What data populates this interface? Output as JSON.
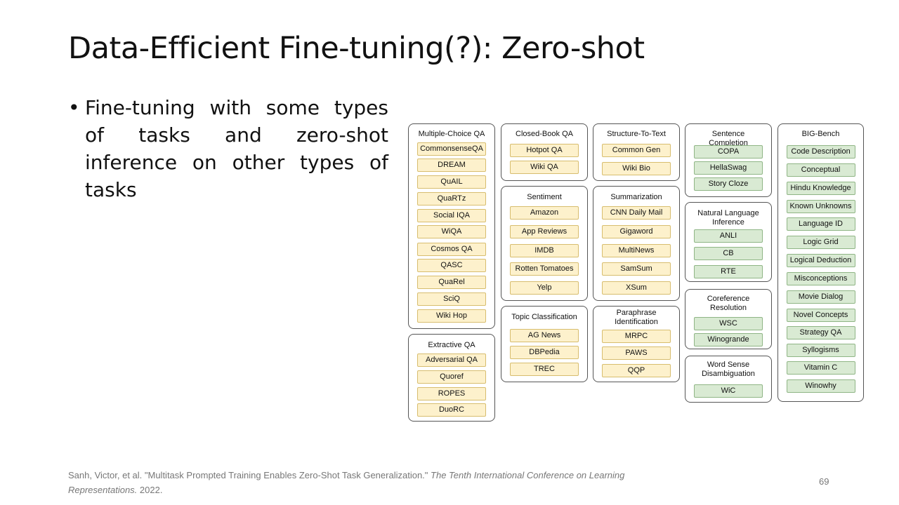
{
  "slide": {
    "title": "Data-Efficient Fine-tuning(?): Zero-shot",
    "bullet_marker": "•",
    "bullet": "Fine-tuning with some types of tasks and zero-shot inference on other types of tasks",
    "citation": {
      "text": "Sanh, Victor, et al. \"Multitask Prompted Training Enables Zero-Shot Task Generalization.\"",
      "venue": "The Tenth International Conference on Learning Representations.",
      "year": "2022."
    },
    "page_number": "69"
  },
  "colors": {
    "training_chip_fill": "#fdf1cc",
    "training_chip_border": "#d7bd6e",
    "heldout_chip_fill": "#d9ead3",
    "heldout_chip_border": "#8fb585"
  },
  "diagram": {
    "groups": [
      {
        "name": "Multiple-Choice QA",
        "split": "train",
        "tasks": [
          "CommonsenseQA",
          "DREAM",
          "QuAIL",
          "QuaRTz",
          "Social IQA",
          "WiQA",
          "Cosmos QA",
          "QASC",
          "QuaRel",
          "SciQ",
          "Wiki Hop"
        ]
      },
      {
        "name": "Extractive QA",
        "split": "train",
        "tasks": [
          "Adversarial QA",
          "Quoref",
          "ROPES",
          "DuoRC"
        ]
      },
      {
        "name": "Closed-Book QA",
        "split": "train",
        "tasks": [
          "Hotpot QA",
          "Wiki QA"
        ]
      },
      {
        "name": "Sentiment",
        "split": "train",
        "tasks": [
          "Amazon",
          "App Reviews",
          "IMDB",
          "Rotten Tomatoes",
          "Yelp"
        ]
      },
      {
        "name": "Topic Classification",
        "split": "train",
        "tasks": [
          "AG News",
          "DBPedia",
          "TREC"
        ]
      },
      {
        "name": "Structure-To-Text",
        "split": "train",
        "tasks": [
          "Common Gen",
          "Wiki Bio"
        ]
      },
      {
        "name": "Summarization",
        "split": "train",
        "tasks": [
          "CNN Daily Mail",
          "Gigaword",
          "MultiNews",
          "SamSum",
          "XSum"
        ]
      },
      {
        "name": "Paraphrase Identification",
        "split": "train",
        "tasks": [
          "MRPC",
          "PAWS",
          "QQP"
        ]
      },
      {
        "name": "Sentence Completion",
        "split": "heldout",
        "tasks": [
          "COPA",
          "HellaSwag",
          "Story Cloze"
        ]
      },
      {
        "name": "Natural Language Inference",
        "split": "heldout",
        "tasks": [
          "ANLI",
          "CB",
          "RTE"
        ]
      },
      {
        "name": "Coreference Resolution",
        "split": "heldout",
        "tasks": [
          "WSC",
          "Winogrande"
        ]
      },
      {
        "name": "Word Sense Disambiguation",
        "split": "heldout",
        "tasks": [
          "WiC"
        ]
      },
      {
        "name": "BIG-Bench",
        "split": "heldout",
        "tasks": [
          "Code Description",
          "Conceptual",
          "Hindu Knowledge",
          "Known Unknowns",
          "Language ID",
          "Logic Grid",
          "Logical Deduction",
          "Misconceptions",
          "Movie Dialog",
          "Novel Concepts",
          "Strategy QA",
          "Syllogisms",
          "Vitamin C",
          "Winowhy"
        ]
      }
    ]
  }
}
